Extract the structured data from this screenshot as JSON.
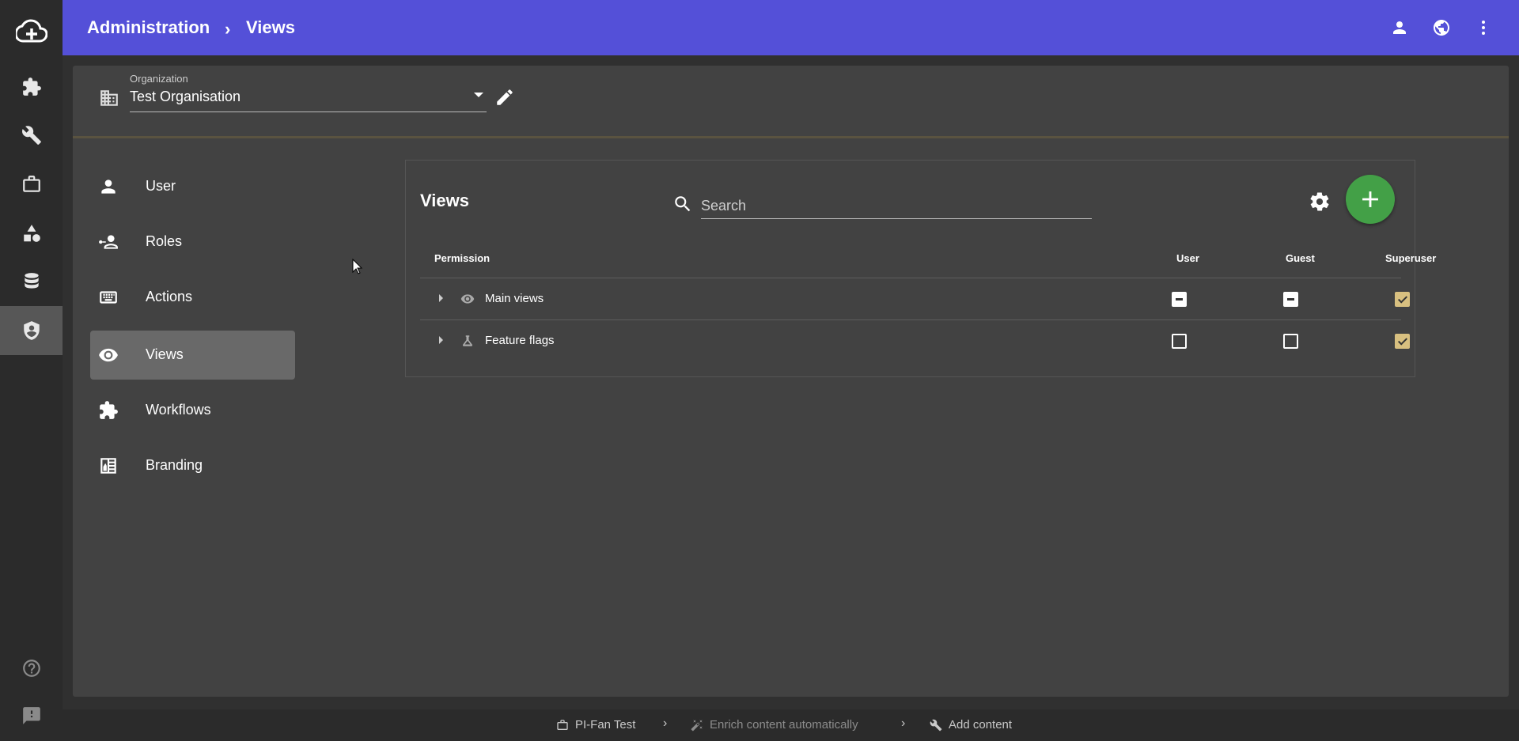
{
  "header": {
    "breadcrumb": [
      "Administration",
      "Views"
    ],
    "separator": "›"
  },
  "organization": {
    "label": "Organization",
    "value": "Test Organisation"
  },
  "nav": {
    "items": [
      {
        "label": "User",
        "icon": "person-icon"
      },
      {
        "label": "Roles",
        "icon": "roles-icon"
      },
      {
        "label": "Actions",
        "icon": "keyboard-icon"
      },
      {
        "label": "Views",
        "icon": "eye-icon",
        "active": true
      },
      {
        "label": "Workflows",
        "icon": "puzzle-icon"
      },
      {
        "label": "Branding",
        "icon": "branding-icon"
      }
    ]
  },
  "views_card": {
    "title": "Views",
    "search_placeholder": "Search",
    "columns": [
      "Permission",
      "User",
      "Guest",
      "Superuser"
    ],
    "rows": [
      {
        "label": "Main views",
        "icon": "eye-icon",
        "user": "indeterminate",
        "guest": "indeterminate",
        "superuser": "checked"
      },
      {
        "label": "Feature flags",
        "icon": "flask-icon",
        "user": "unchecked",
        "guest": "unchecked",
        "superuser": "checked"
      }
    ]
  },
  "statusbar": {
    "items": [
      "PI-Fan Test",
      "Enrich content automatically",
      "Add content"
    ],
    "separator": "›"
  },
  "colors": {
    "topbar": "#5450d8",
    "fab": "#43a047",
    "checked": "#d8c080"
  }
}
